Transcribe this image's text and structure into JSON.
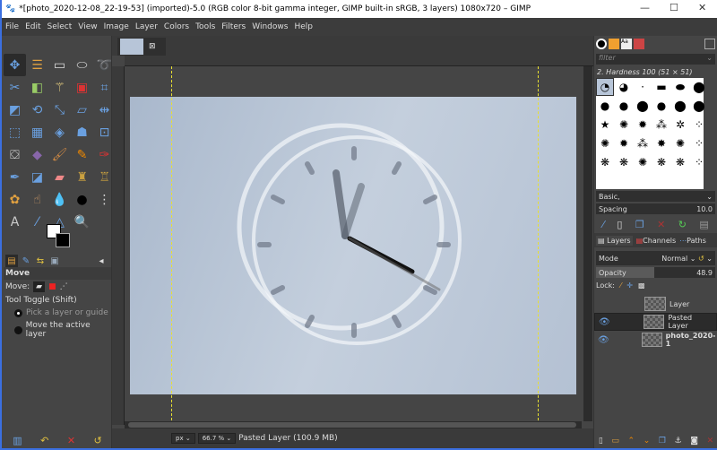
{
  "window": {
    "title": "*[photo_2020-12-08_22-19-53] (imported)-5.0 (RGB color 8-bit gamma integer, GIMP built-in sRGB, 3 layers) 1080x720 – GIMP"
  },
  "menu": [
    "File",
    "Edit",
    "Select",
    "View",
    "Image",
    "Layer",
    "Colors",
    "Tools",
    "Filters",
    "Windows",
    "Help"
  ],
  "tools": [
    {
      "n": "move",
      "g": "✥",
      "c": "#6aa0e0"
    },
    {
      "n": "align",
      "g": "☰",
      "c": "#e0a040"
    },
    {
      "n": "rect-select",
      "g": "▭",
      "c": "#ddd"
    },
    {
      "n": "ellipse-select",
      "g": "⬭",
      "c": "#ddd"
    },
    {
      "n": "free-select",
      "g": "➰",
      "c": "#ccc"
    },
    {
      "n": "scissors",
      "g": "✂",
      "c": "#6aa0e0"
    },
    {
      "n": "foreground-select",
      "g": "◧",
      "c": "#9c6"
    },
    {
      "n": "fuzzy-select",
      "g": "⚚",
      "c": "#e8d080"
    },
    {
      "n": "color-select",
      "g": "▣",
      "c": "#d33"
    },
    {
      "n": "crop",
      "g": "⌗",
      "c": "#6aa0e0"
    },
    {
      "n": "unified-transform",
      "g": "◩",
      "c": "#6aa0e0"
    },
    {
      "n": "rotate",
      "g": "⟲",
      "c": "#6aa0e0"
    },
    {
      "n": "scale",
      "g": "⤡",
      "c": "#6aa0e0"
    },
    {
      "n": "shear",
      "g": "▱",
      "c": "#6aa0e0"
    },
    {
      "n": "flip",
      "g": "⇹",
      "c": "#6aa0e0"
    },
    {
      "n": "perspective",
      "g": "⬚",
      "c": "#6aa0e0"
    },
    {
      "n": "cage",
      "g": "▦",
      "c": "#6aa0e0"
    },
    {
      "n": "warp",
      "g": "◈",
      "c": "#6aa0e0"
    },
    {
      "n": "handle-transform",
      "g": "☗",
      "c": "#6aa0e0"
    },
    {
      "n": "n-point",
      "g": "⊡",
      "c": "#6aa0e0"
    },
    {
      "n": "bucket-fill",
      "g": "⛋",
      "c": "#ddd"
    },
    {
      "n": "gradient",
      "g": "◆",
      "c": "#86a"
    },
    {
      "n": "paintbrush",
      "g": "🖌",
      "c": "#c84"
    },
    {
      "n": "pencil",
      "g": "✎",
      "c": "#e80"
    },
    {
      "n": "airbrush",
      "g": "✑",
      "c": "#d33"
    },
    {
      "n": "ink",
      "g": "✒",
      "c": "#6aa0e0"
    },
    {
      "n": "mypaint",
      "g": "◪",
      "c": "#6aa0e0"
    },
    {
      "n": "eraser",
      "g": "▰",
      "c": "#e88"
    },
    {
      "n": "clone",
      "g": "♜",
      "c": "#c9a040"
    },
    {
      "n": "heal",
      "g": "♖",
      "c": "#c9a040"
    },
    {
      "n": "perspective-clone",
      "g": "✿",
      "c": "#e0a040"
    },
    {
      "n": "smudge",
      "g": "☝",
      "c": "#c96"
    },
    {
      "n": "blur",
      "g": "💧",
      "c": "#6aa0e0"
    },
    {
      "n": "dodge-burn",
      "g": "●",
      "c": "#000"
    },
    {
      "n": "paths",
      "g": "⋮",
      "c": "#ddd"
    },
    {
      "n": "text",
      "g": "A",
      "c": "#ccc"
    },
    {
      "n": "color-picker",
      "g": "⁄",
      "c": "#6aa0e0"
    },
    {
      "n": "measure",
      "g": "△",
      "c": "#6aa0e0"
    },
    {
      "n": "zoom",
      "g": "🔍",
      "c": "#6aa0e0"
    }
  ],
  "tool_options": {
    "title": "Move",
    "move_label": "Move:",
    "toggle_label": "Tool Toggle  (Shift)",
    "option1": "Pick a layer or guide",
    "option2": "Move the active layer"
  },
  "status": {
    "unit": "px",
    "zoom": "66.7 %",
    "message": "Pasted Layer (100.9 MB)"
  },
  "brushes": {
    "filter_placeholder": "filter",
    "current": "2. Hardness 100 (51 × 51)",
    "preset": "Basic,",
    "spacing_label": "Spacing",
    "spacing_value": "10.0"
  },
  "layers_panel": {
    "tabs": [
      "Layers",
      "Channels",
      "Paths"
    ],
    "mode_label": "Mode",
    "mode_value": "Normal",
    "opacity_label": "Opacity",
    "opacity_value": "48.9",
    "opacity_percent": 48.9,
    "lock_label": "Lock:",
    "layers": [
      {
        "name": "Layer",
        "visible": false
      },
      {
        "name": "Pasted Layer",
        "visible": true
      },
      {
        "name": "photo_2020-1",
        "visible": true
      }
    ]
  }
}
